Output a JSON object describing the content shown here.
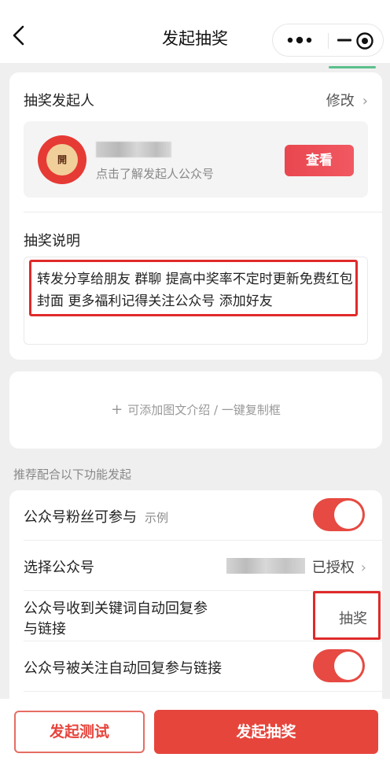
{
  "navbar": {
    "title": "发起抽奖",
    "back_icon": "back-arrow-icon",
    "capsule_icons": [
      "more-icon",
      "minimize-icon",
      "target-icon"
    ]
  },
  "organizer": {
    "title": "抽奖发起人",
    "modify_label": "修改",
    "avatar_text": "開",
    "desc": "点击了解发起人公众号",
    "view_button": "查看"
  },
  "description": {
    "title": "抽奖说明",
    "text": "转发分享给朋友 群聊 提高中奖率不定时更新免费红包封面 更多福利记得关注公众号 添加好友"
  },
  "add_card": {
    "label": "可添加图文介绍 / 一键复制框"
  },
  "settings": {
    "hint": "推荐配合以下功能发起",
    "rows": [
      {
        "label": "公众号粉丝可参与",
        "example": "示例",
        "toggle_on": true
      },
      {
        "label": "选择公众号",
        "status": "已授权"
      },
      {
        "label": "公众号收到关键词自动回复参与链接",
        "keyword": "抽奖"
      },
      {
        "label": "公众号被关注自动回复参与链接",
        "toggle_on": true
      }
    ]
  },
  "bottom": {
    "test_button": "发起测试",
    "start_button": "发起抽奖"
  },
  "colors": {
    "accent": "#e6453c",
    "highlight_border": "#e02a2a",
    "background": "#efefef"
  }
}
